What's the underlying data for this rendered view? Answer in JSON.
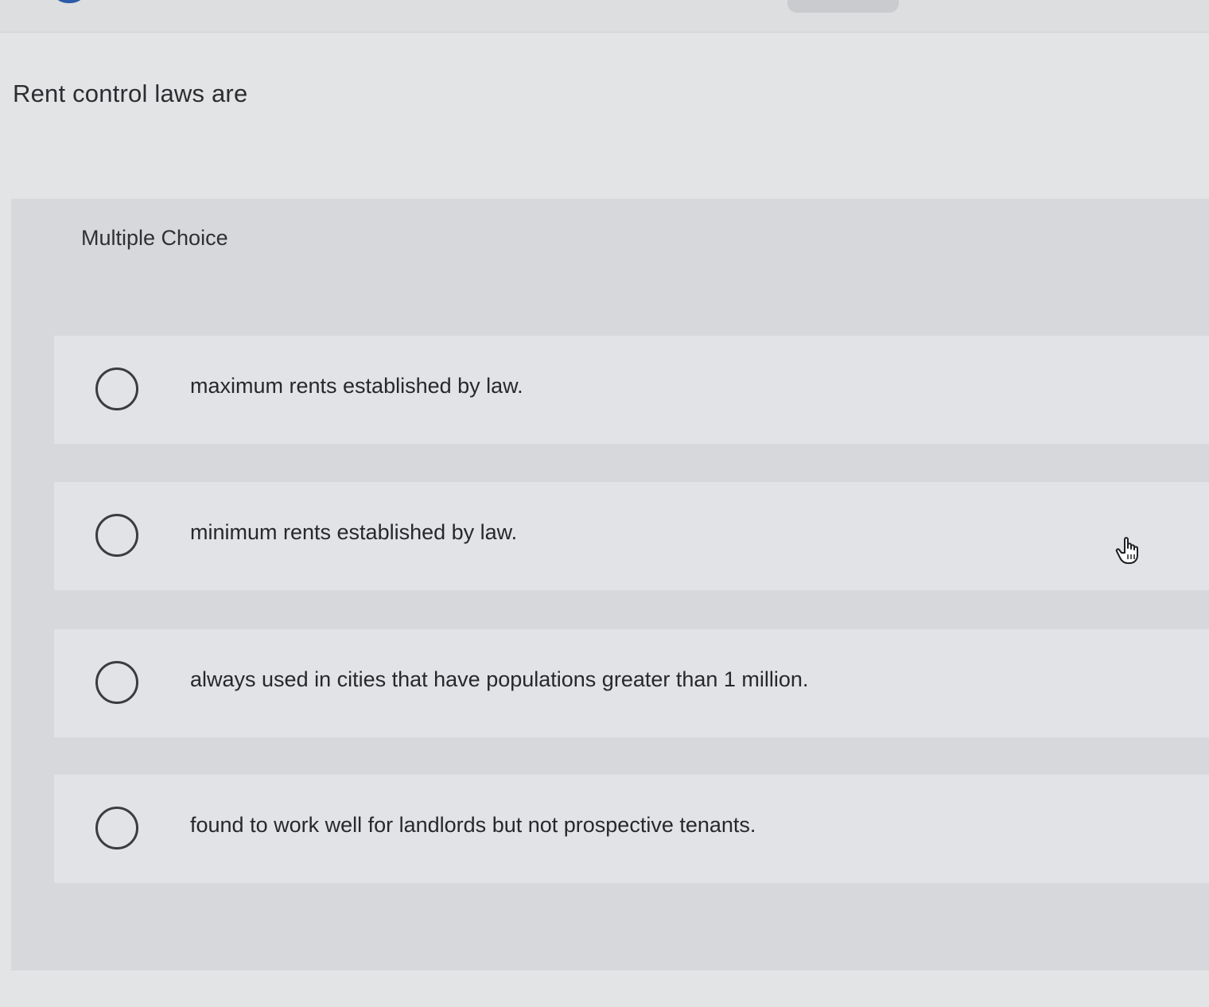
{
  "question": {
    "text": "Rent control laws are"
  },
  "multiple_choice": {
    "label": "Multiple Choice",
    "options": [
      {
        "text": "maximum rents established by law.",
        "selected": false
      },
      {
        "text": "minimum rents established by law.",
        "selected": false
      },
      {
        "text": "always used in cities that have populations greater than 1 million.",
        "selected": false
      },
      {
        "text": "found to work well for landlords but not prospective tenants.",
        "selected": false
      }
    ]
  },
  "cursor": {
    "icon": "hand-pointer-icon"
  }
}
